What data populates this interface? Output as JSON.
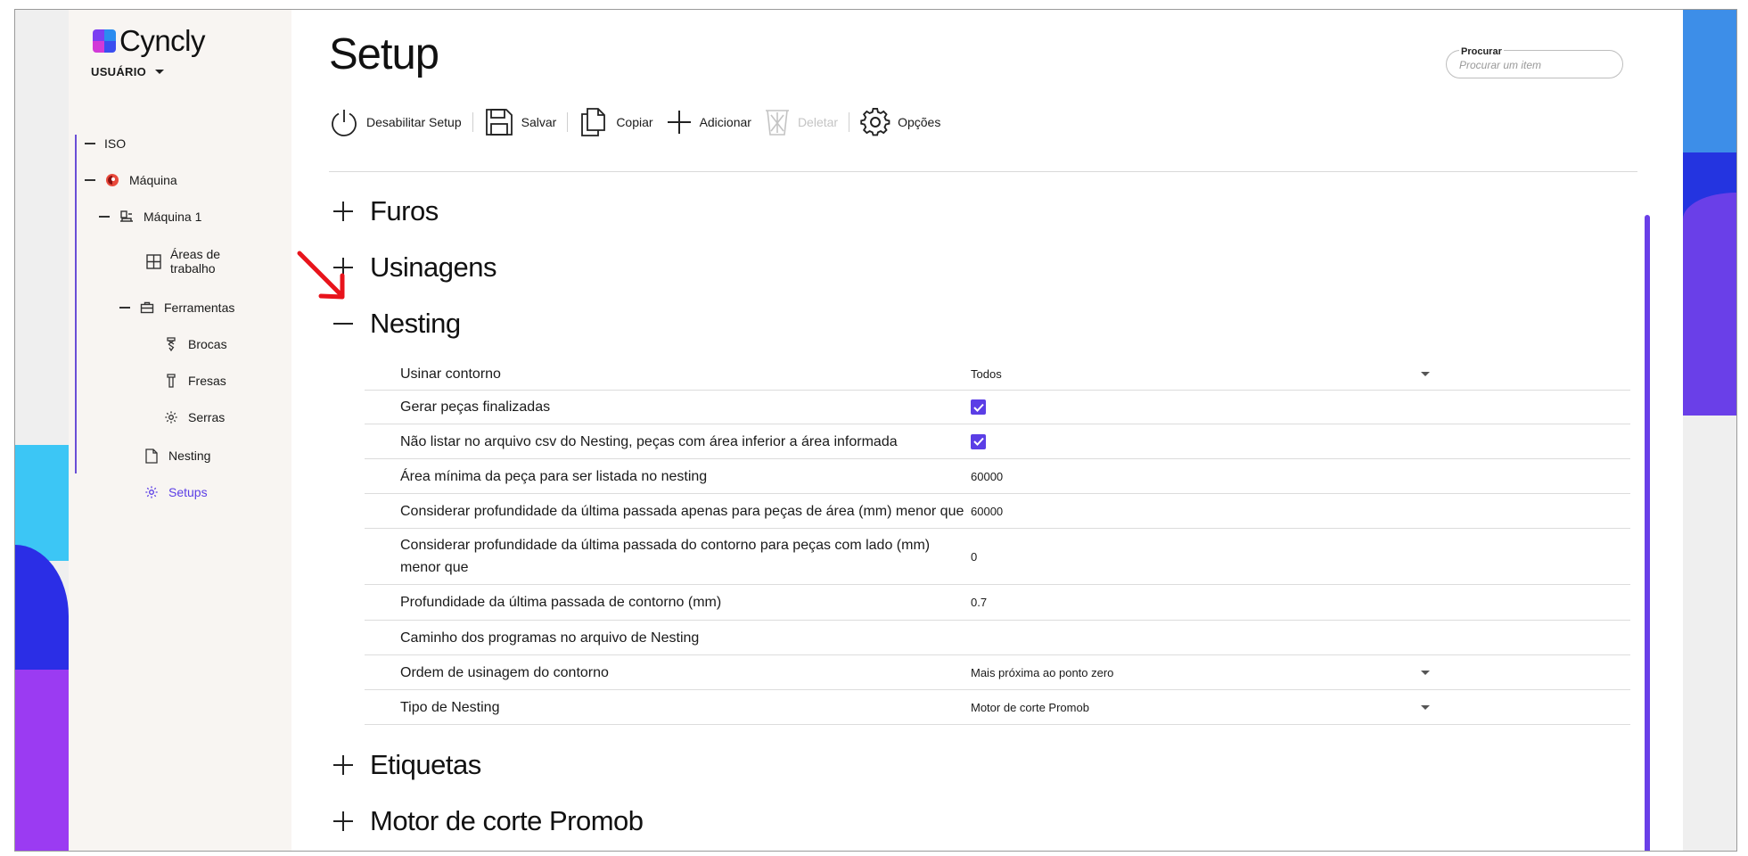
{
  "app": {
    "logo_text": "Cyncly",
    "user_label": "USUÁRIO"
  },
  "sidebar": {
    "items": [
      {
        "label": "ISO",
        "icon": "minus-icon"
      },
      {
        "label": "Máquina",
        "icon": "machine-brand-icon"
      },
      {
        "label": "Máquina 1",
        "icon": "cnc-machine-icon"
      },
      {
        "label_line1": "Áreas de",
        "label_line2": "trabalho",
        "icon": "grid-icon"
      },
      {
        "label": "Ferramentas",
        "icon": "toolbox-icon"
      },
      {
        "label": "Brocas",
        "icon": "drill-bit-icon"
      },
      {
        "label": "Fresas",
        "icon": "milling-cutter-icon"
      },
      {
        "label": "Serras",
        "icon": "saw-gear-icon"
      },
      {
        "label": "Nesting",
        "icon": "document-icon"
      },
      {
        "label": "Setups",
        "icon": "gear-icon"
      }
    ]
  },
  "page": {
    "title": "Setup"
  },
  "search": {
    "label": "Procurar",
    "placeholder": "Procurar um item"
  },
  "toolbar": {
    "disable_label": "Desabilitar Setup",
    "save_label": "Salvar",
    "copy_label": "Copiar",
    "add_label": "Adicionar",
    "delete_label": "Deletar",
    "options_label": "Opções"
  },
  "sections": {
    "furos": "Furos",
    "usinagens": "Usinagens",
    "nesting": "Nesting",
    "etiquetas": "Etiquetas",
    "motor": "Motor de corte Promob"
  },
  "nesting": {
    "rows": [
      {
        "label": "Usinar contorno",
        "value": "Todos",
        "type": "select"
      },
      {
        "label": "Gerar peças finalizadas",
        "value": true,
        "type": "checkbox"
      },
      {
        "label": "Não listar no arquivo csv do Nesting, peças com área inferior a área informada",
        "value": true,
        "type": "checkbox"
      },
      {
        "label": "Área mínima da peça para ser listada no nesting",
        "value": "60000",
        "type": "number"
      },
      {
        "label": "Considerar profundidade da última passada apenas para peças de área (mm) menor que",
        "value": "60000",
        "type": "number"
      },
      {
        "label": "Considerar profundidade da última passada do contorno para peças com lado (mm) menor que",
        "value": "0",
        "type": "number"
      },
      {
        "label": "Profundidade da última passada de contorno (mm)",
        "value": "0.7",
        "type": "number"
      },
      {
        "label": "Caminho dos programas no arquivo de Nesting",
        "value": "",
        "type": "text"
      },
      {
        "label": "Ordem de usinagem do contorno",
        "value": "Mais próxima ao ponto zero",
        "type": "select"
      },
      {
        "label": "Tipo de Nesting",
        "value": "Motor de corte Promob",
        "type": "select"
      }
    ]
  },
  "colors": {
    "accent": "#5b3ee6",
    "annotation_arrow": "#e8141c"
  }
}
